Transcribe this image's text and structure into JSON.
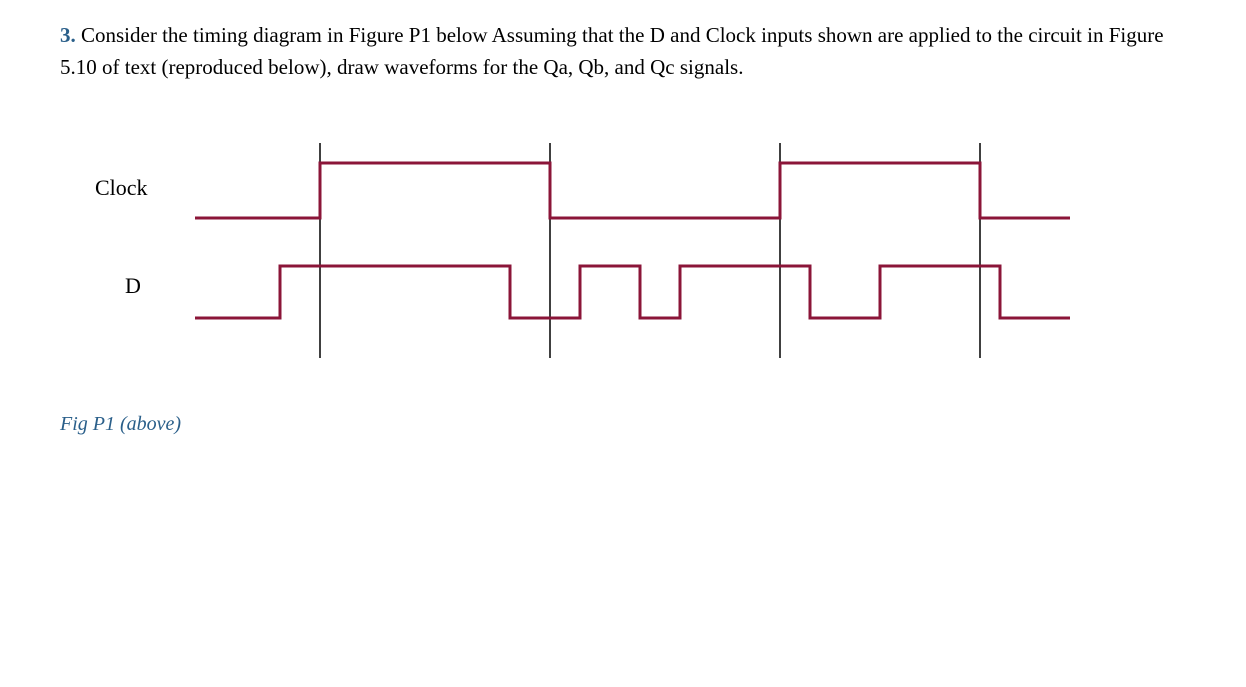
{
  "question": {
    "number": "3.",
    "text_part1": " Consider the timing diagram in Figure P1 below  Assuming that the D and Clock inputs shown are applied to the circuit in Figure 5.10 of text (reproduced below), draw waveforms for the Qa, Qb, and Qc signals."
  },
  "signals": {
    "clock_label": "Clock",
    "d_label": "D"
  },
  "caption": "Fig P1 (above)",
  "chart_data": {
    "type": "timing-diagram",
    "time_axis_ticks": [
      240,
      470,
      700,
      900
    ],
    "signals": [
      {
        "name": "Clock",
        "transitions": [
          {
            "time": 0,
            "level": 0
          },
          {
            "time": 240,
            "level": 1
          },
          {
            "time": 470,
            "level": 0
          },
          {
            "time": 700,
            "level": 1
          },
          {
            "time": 900,
            "level": 0
          }
        ]
      },
      {
        "name": "D",
        "transitions": [
          {
            "time": 0,
            "level": 0
          },
          {
            "time": 200,
            "level": 1
          },
          {
            "time": 430,
            "level": 0
          },
          {
            "time": 500,
            "level": 1
          },
          {
            "time": 560,
            "level": 0
          },
          {
            "time": 600,
            "level": 1
          },
          {
            "time": 730,
            "level": 0
          },
          {
            "time": 800,
            "level": 1
          },
          {
            "time": 920,
            "level": 0
          }
        ]
      }
    ]
  }
}
